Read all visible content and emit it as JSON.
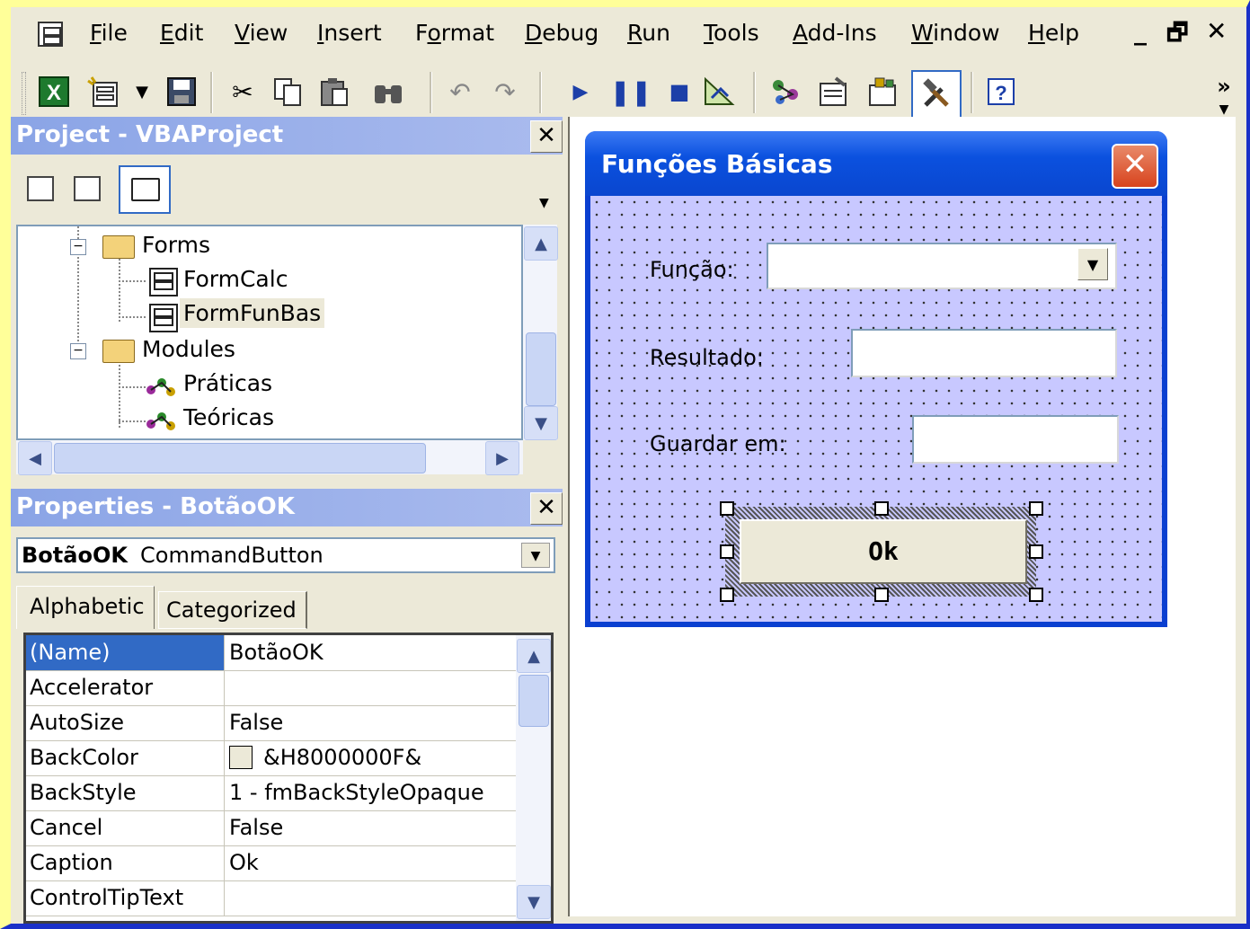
{
  "menu": {
    "items": [
      {
        "label": "File",
        "ul": "F",
        "rest": "ile"
      },
      {
        "label": "Edit",
        "ul": "E",
        "rest": "dit"
      },
      {
        "label": "View",
        "ul": "V",
        "rest": "iew"
      },
      {
        "label": "Insert",
        "ul": "I",
        "rest": "nsert"
      },
      {
        "label": "Format",
        "pre": "F",
        "ul": "o",
        "rest": "rmat"
      },
      {
        "label": "Debug",
        "ul": "D",
        "rest": "ebug"
      },
      {
        "label": "Run",
        "ul": "R",
        "rest": "un"
      },
      {
        "label": "Tools",
        "ul": "T",
        "rest": "ools"
      },
      {
        "label": "Add-Ins",
        "ul": "A",
        "rest": "dd-Ins"
      },
      {
        "label": "Window",
        "ul": "W",
        "rest": "indow"
      },
      {
        "label": "Help",
        "ul": "H",
        "rest": "elp"
      }
    ],
    "window_controls": {
      "minimize": "_",
      "restore": "🗗",
      "close": "✕"
    }
  },
  "toolbar": {
    "more": "»",
    "icons": [
      "excel-icon",
      "insert-userform-icon",
      "save-icon",
      "cut-icon",
      "copy-icon",
      "paste-icon",
      "find-icon",
      "undo-icon",
      "redo-icon",
      "run-icon",
      "break-icon",
      "reset-icon",
      "design-mode-icon",
      "project-explorer-icon",
      "properties-window-icon",
      "object-browser-icon",
      "toolbox-icon",
      "help-icon"
    ]
  },
  "project": {
    "title": "Project - VBAProject",
    "close": "✕",
    "tree": {
      "forms_label": "Forms",
      "forms": [
        "FormCalc",
        "FormFunBas"
      ],
      "selected": "FormFunBas",
      "modules_label": "Modules",
      "modules": [
        "Práticas",
        "Teóricas"
      ]
    }
  },
  "properties": {
    "title": "Properties - BotãoOK",
    "close": "✕",
    "object_name": "BotãoOK",
    "object_type": "CommandButton",
    "tabs": [
      "Alphabetic",
      "Categorized"
    ],
    "active_tab": "Alphabetic",
    "rows": [
      {
        "name": "(Name)",
        "value": "BotãoOK"
      },
      {
        "name": "Accelerator",
        "value": ""
      },
      {
        "name": "AutoSize",
        "value": "False"
      },
      {
        "name": "BackColor",
        "value": "&H8000000F&",
        "swatch": "#ece9d8"
      },
      {
        "name": "BackStyle",
        "value": "1 - fmBackStyleOpaque"
      },
      {
        "name": "Cancel",
        "value": "False"
      },
      {
        "name": "Caption",
        "value": "Ok"
      },
      {
        "name": "ControlTipText",
        "value": ""
      }
    ],
    "selected_row": "(Name)"
  },
  "userform": {
    "title": "Funções Básicas",
    "close": "✕",
    "funcao_label": "Função:",
    "funcao_value": "",
    "resultado_label": "Resultado:",
    "resultado_value": "",
    "guardar_label": "Guardar em:",
    "guardar_value": "",
    "ok_caption": "Ok"
  },
  "colors": {
    "chrome": "#ece9d8",
    "form_client": "#c8c8ff",
    "title_blue": "#0b51df",
    "panel_title": "#8aa4e6",
    "page_bg": "#ffff99"
  }
}
